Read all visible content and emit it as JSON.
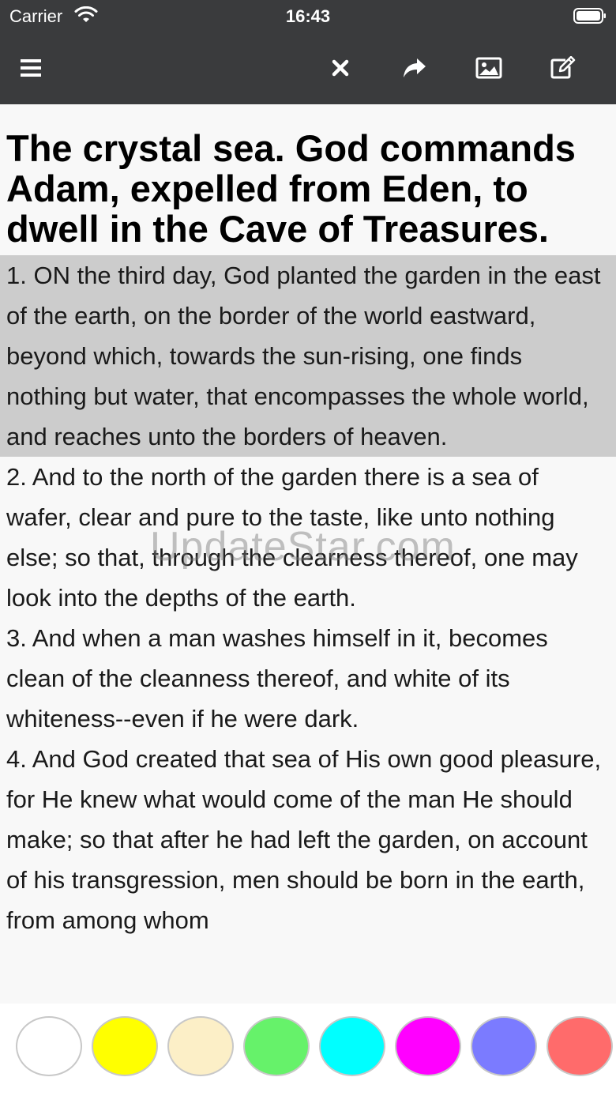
{
  "status_bar": {
    "carrier": "Carrier",
    "time": "16:43"
  },
  "toolbar": {
    "menu_icon": "hamburger-menu-icon",
    "close_icon": "close-icon",
    "share_icon": "share-arrow-icon",
    "image_icon": "image-icon",
    "edit_icon": "edit-note-icon"
  },
  "chapter": {
    "title": "The crystal sea. God commands Adam, expelled from Eden, to dwell in the Cave of Treasures.",
    "verses": [
      {
        "text": "1. ON the third day, God planted the garden in the east of the earth, on the border of the world eastward, beyond which, towards the sun-rising, one finds nothing but water, that encompasses the whole world, and reaches unto the borders of heaven.",
        "highlighted": true
      },
      {
        "text": "2. And to the north of the garden there is a sea of wafer, clear and pure to the taste, like unto nothing else; so that, through the clearness thereof, one may look into the depths of the earth.",
        "highlighted": false
      },
      {
        "text": "3. And when a man washes himself in it, becomes clean of the cleanness thereof, and white of its whiteness--even if he were dark.",
        "highlighted": false
      },
      {
        "text": "4. And God created that sea of His own good pleasure, for He knew what would come of the man He should make; so that after he had left the garden, on account of his transgression, men should be born in the earth, from among whom",
        "highlighted": false
      }
    ]
  },
  "watermark": "UpdateStar.com",
  "highlight_colors": [
    "#ffffff",
    "#ffff00",
    "#fcefc7",
    "#66f26a",
    "#00ffff",
    "#ff00ff",
    "#7b7bff",
    "#ff6b6b"
  ],
  "colors": {
    "bar_bg": "#3a3b3d",
    "highlight_bg": "#cccccc",
    "content_bg": "#f8f8f8"
  }
}
